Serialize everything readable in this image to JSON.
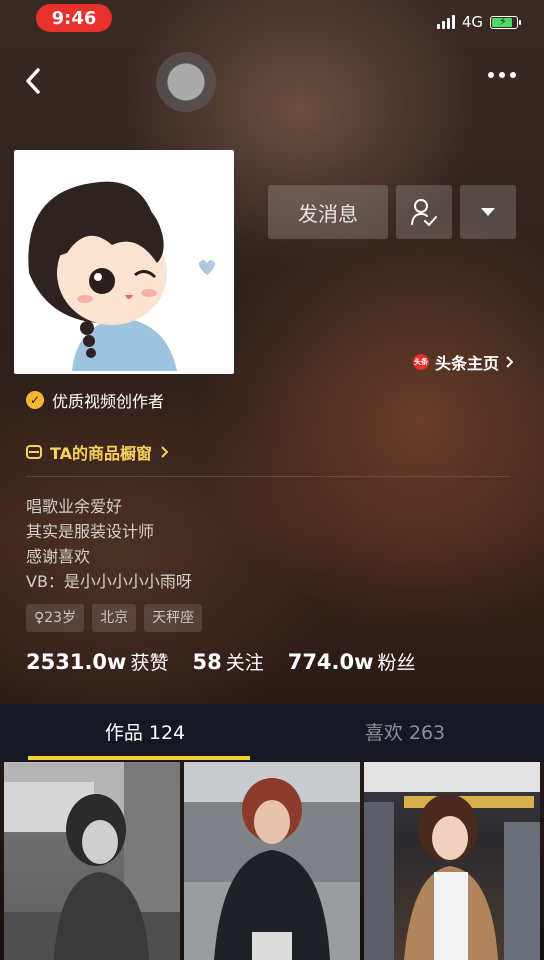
{
  "status_bar": {
    "time": "9:46",
    "network": "4G"
  },
  "profile": {
    "message_button": "发消息",
    "toutiao_icon_text": "头条",
    "toutiao_link": "头条主页",
    "creator_badge": "优质视频创作者",
    "shop_link": "TA的商品橱窗",
    "bio": [
      "唱歌业余爱好",
      "其实是服装设计师",
      "感谢喜欢",
      "VB：是小小小小小雨呀"
    ],
    "tags": [
      "♀23岁",
      "北京",
      "天秤座"
    ],
    "stats": [
      {
        "value": "2531.0w",
        "label": "获赞"
      },
      {
        "value": "58",
        "label": "关注"
      },
      {
        "value": "774.0w",
        "label": "粉丝"
      }
    ]
  },
  "tabs": [
    {
      "label": "作品 124",
      "active": true
    },
    {
      "label": "喜欢 263",
      "active": false
    }
  ],
  "colors": {
    "accent": "#f9d12c",
    "time_pill": "#e8302c",
    "shop": "#f7d25b"
  }
}
